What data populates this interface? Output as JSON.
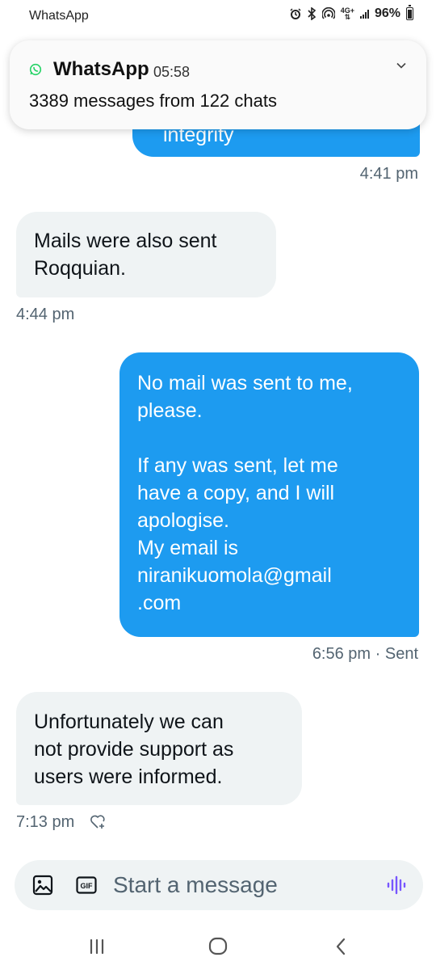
{
  "status_bar": {
    "app_label": "WhatsApp",
    "network": "4G+",
    "battery": "96%"
  },
  "notification": {
    "app_name": "WhatsApp",
    "time": "05:58",
    "summary": "3389 messages from 122 chats",
    "icon": "whatsapp-icon"
  },
  "conversation": {
    "partial_bubble_text": "integrity",
    "partial_bubble_time": "4:41 pm",
    "messages": [
      {
        "direction": "in",
        "lines": [
          "Mails were also sent",
          "Roqquian."
        ],
        "time": "4:44 pm"
      },
      {
        "direction": "out",
        "lines": [
          "No mail was sent to me,",
          "please.",
          "",
          "If any was sent, let me",
          "have a copy, and I will",
          "apologise.",
          "My email is",
          "niranikuomola@gmail",
          ".com"
        ],
        "time": "6:56 pm · Sent"
      },
      {
        "direction": "in",
        "lines": [
          "Unfortunately we can",
          "not provide support as",
          "users were informed."
        ],
        "time": "7:13 pm",
        "reaction_icon": "heart-plus-icon"
      }
    ]
  },
  "composer": {
    "placeholder": "Start a message",
    "icons": [
      "image-icon",
      "gif-icon",
      "voice-icon"
    ],
    "voice_color": "#7856ff"
  },
  "nav_bar": {
    "icons": [
      "recent-apps-icon",
      "home-icon",
      "back-icon"
    ]
  },
  "colors": {
    "outgoing_bubble": "#1d9bf0",
    "incoming_bubble": "#eff3f4",
    "timestamp": "#536471"
  }
}
